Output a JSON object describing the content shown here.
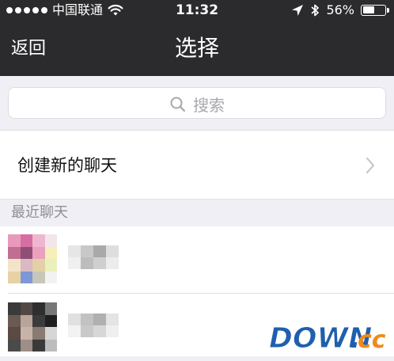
{
  "status_bar": {
    "carrier": "中国联通",
    "time": "11:32",
    "battery": "56%",
    "battery_level": 0.56,
    "icons": [
      "signal-dots-icon",
      "wifi-icon",
      "location-arrow-icon",
      "bluetooth-icon",
      "battery-icon"
    ]
  },
  "navbar": {
    "back_label": "返回",
    "title": "选择"
  },
  "search": {
    "placeholder": "搜索",
    "icon": "search-icon"
  },
  "create_chat": {
    "label": "创建新的聊天",
    "icon": "chevron-right-icon"
  },
  "recent": {
    "header": "最近聊天",
    "items": [
      {
        "avatar": "pixelated-avatar",
        "name": ""
      },
      {
        "avatar": "pixelated-avatar",
        "name": ""
      }
    ]
  },
  "watermark": {
    "text_main": "DOWN",
    "text_dot": ".",
    "text_tld": "cc",
    "color_primary": "#1f5fae",
    "color_accent": "#f08a1c"
  },
  "colors": {
    "bar_bg": "#2b2b2d",
    "page_bg": "#f0eff5",
    "text_secondary": "#8e8e93"
  }
}
